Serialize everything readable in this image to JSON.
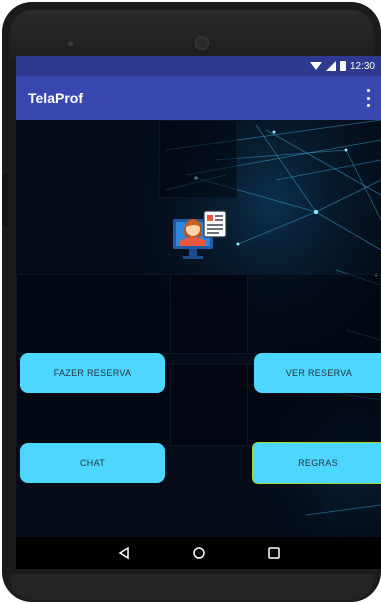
{
  "status_bar": {
    "time": "12:30",
    "icons": [
      "wifi-icon",
      "signal-icon",
      "battery-icon"
    ]
  },
  "app_bar": {
    "title": "TelaProf",
    "menu_icon": "more-vert-icon"
  },
  "content": {
    "center_icon": "teacher-profile-icon",
    "buttons": {
      "fazer_reserva": "FAZER RESERVA",
      "ver_reserva": "VER RESERVA",
      "chat": "CHAT",
      "regras": "REGRAS"
    }
  },
  "nav_bar": {
    "icons": [
      "back-icon",
      "home-icon",
      "recent-apps-icon"
    ]
  },
  "colors": {
    "status_bar": "#2d3a90",
    "app_bar": "#3848b0",
    "background": "#040c18",
    "button": "#4dd6ff",
    "button_text": "#2a3340",
    "selected_border": "#a8d82a"
  }
}
